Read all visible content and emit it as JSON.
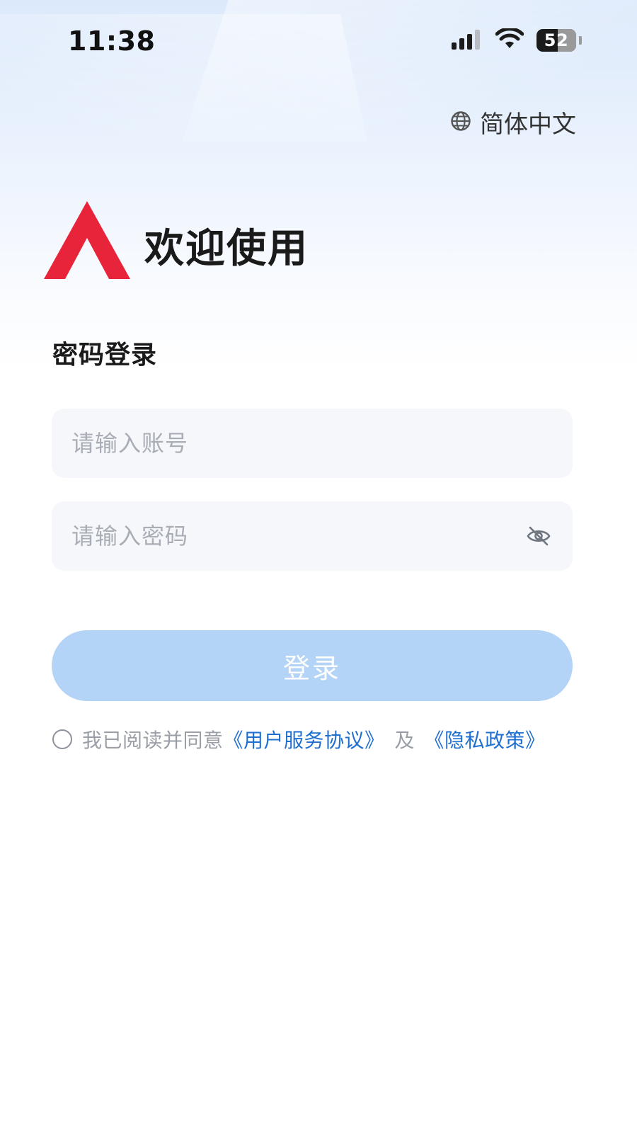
{
  "status_bar": {
    "time": "11:38",
    "battery": "52",
    "icons": [
      "signal-icon",
      "wifi-icon",
      "battery-icon"
    ]
  },
  "language": {
    "icon": "globe-icon",
    "label": "简体中文"
  },
  "brand": {
    "logo": "red-triangle-logo",
    "logo_color": "#e8243a",
    "welcome": "欢迎使用"
  },
  "login": {
    "section_title": "密码登录",
    "account_placeholder": "请输入账号",
    "account_value": "",
    "password_placeholder": "请输入密码",
    "password_value": "",
    "password_toggle_icon": "eye-off-icon",
    "submit_label": "登录",
    "submit_color": "#b3d4f7"
  },
  "agreement": {
    "checked": false,
    "prefix": "我已阅读并同意",
    "terms_link": "《用户服务协议》",
    "conjunction": "及",
    "privacy_link": "《隐私政策》",
    "link_color": "#1f6fd1"
  }
}
